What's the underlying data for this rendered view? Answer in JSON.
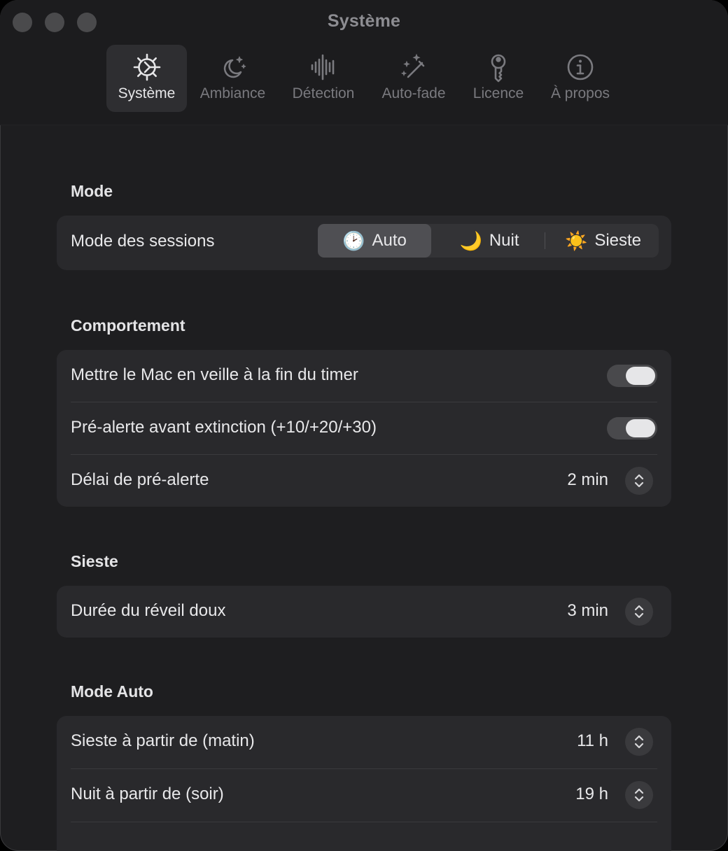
{
  "window": {
    "title": "Système"
  },
  "tabs": [
    {
      "label": "Système",
      "icon": "gear-icon",
      "active": true
    },
    {
      "label": "Ambiance",
      "icon": "moon-stars-icon"
    },
    {
      "label": "Détection",
      "icon": "waveform-icon"
    },
    {
      "label": "Auto-fade",
      "icon": "magic-wand-icon"
    },
    {
      "label": "Licence",
      "icon": "key-icon"
    },
    {
      "label": "À propos",
      "icon": "info-icon"
    }
  ],
  "sections": {
    "mode": {
      "title": "Mode",
      "session_label": "Mode des sessions",
      "options": [
        {
          "emoji": "🕑",
          "label": "Auto",
          "selected": true
        },
        {
          "emoji": "🌙",
          "label": "Nuit"
        },
        {
          "emoji": "☀️",
          "label": "Sieste"
        }
      ]
    },
    "behavior": {
      "title": "Comportement",
      "rows": [
        {
          "label": "Mettre le Mac en veille à la fin du timer",
          "toggle": true
        },
        {
          "label": "Pré-alerte avant extinction (+10/+20/+30)",
          "toggle": true
        },
        {
          "label": "Délai de pré-alerte",
          "value": "2 min"
        }
      ]
    },
    "nap": {
      "title": "Sieste",
      "rows": [
        {
          "label": "Durée du réveil doux",
          "value": "3 min"
        }
      ]
    },
    "auto": {
      "title": "Mode Auto",
      "rows": [
        {
          "label": "Sieste à partir de (matin)",
          "value": "11 h"
        },
        {
          "label": "Nuit à partir de (soir)",
          "value": "19 h"
        }
      ]
    }
  },
  "colors": {
    "window_bg": "#1e1e20",
    "group_bg": "#29292c",
    "accent_active_tab": "#2e2e31"
  }
}
